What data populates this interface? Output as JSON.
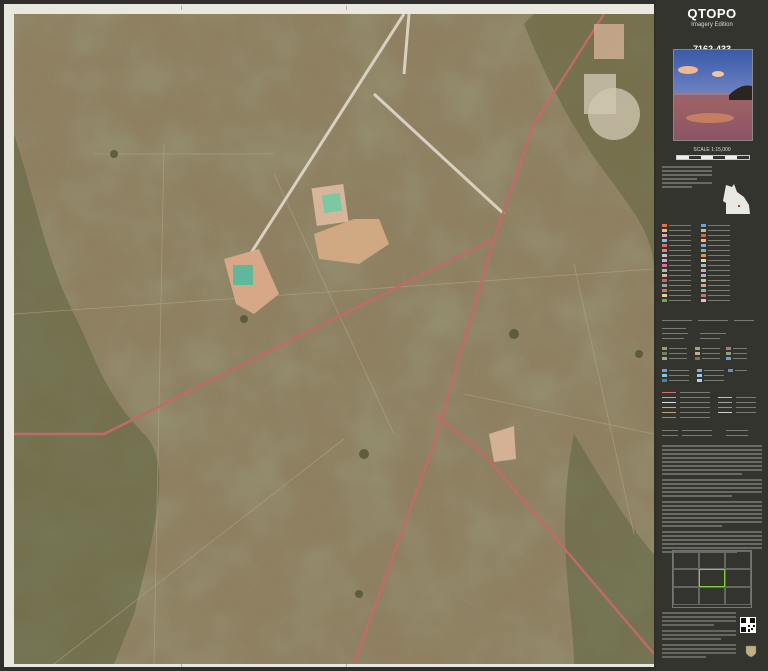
{
  "brand": {
    "title": "QTOPO",
    "edition": "Imagery Edition"
  },
  "sheet": {
    "number": "7162-433"
  },
  "scale": {
    "label": "SCALE 1:15,000"
  },
  "colors": {
    "background": "#2f2f2b",
    "panel": "#34342f",
    "terrain": "#8a7a5c",
    "vegetation": "#6b6a45",
    "road": "#c06a6a",
    "track": "#d8d0c0",
    "cleared": "#d0a882",
    "water": "#7cc8a0",
    "highlight": "#7ccc3c"
  },
  "icons": [
    "queensland-outline-icon",
    "qr-code-icon",
    "coat-of-arms-icon"
  ]
}
